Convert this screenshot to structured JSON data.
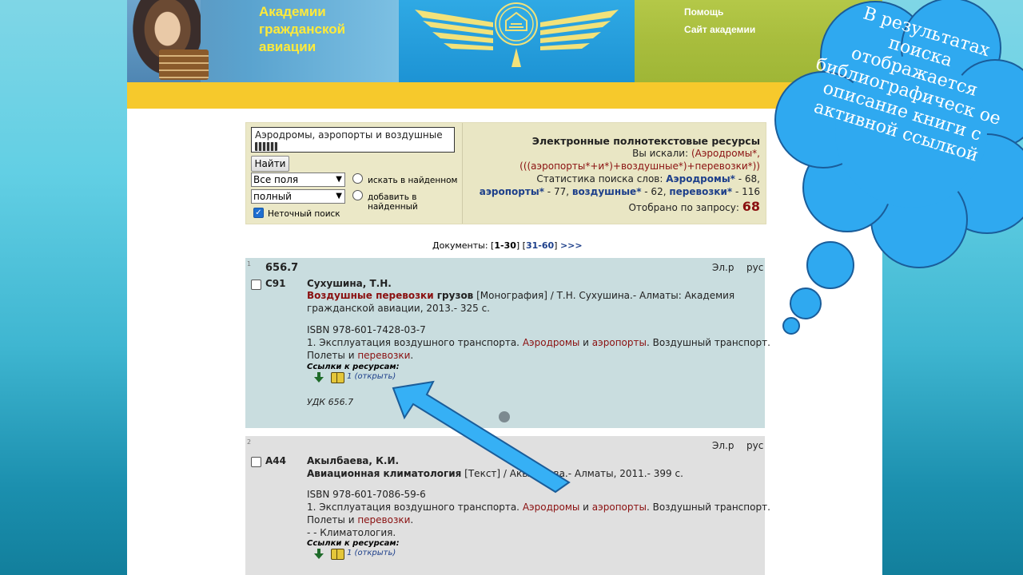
{
  "header": {
    "academy_line1": "Академии",
    "academy_line2": "гражданской",
    "academy_line3": "авиации",
    "help_link": "Помощь",
    "site_link": "Сайт академии"
  },
  "search": {
    "query": "Аэродромы, аэропорты и воздушные",
    "find_button": "Найти",
    "field_select": "Все поля",
    "mode_select": "полный",
    "radio_search_in_found": "искать в найденном",
    "radio_add_to_found": "добавить в найденный",
    "exact_search_label": "Неточный поиск",
    "exact_search_checked": true
  },
  "info": {
    "title": "Электронные полнотекстовые ресурсы",
    "searched_label": "Вы искали:",
    "searched_q1": "(Аэродромы*,",
    "searched_q2": "(((аэропорты*+и*)+воздушные*)+перевозки*))",
    "stats_label": "Статистика поиска слов:",
    "w1": "Аэродромы*",
    "c1": " - 68,",
    "w2": "аэропорты*",
    "c2": " - 77, ",
    "w3": "воздушные*",
    "c3": " - 62, ",
    "w4": "перевозки*",
    "c4": " - 116",
    "selected_label": "Отобрано по запросу:",
    "selected_count": "68"
  },
  "pager": {
    "label": "Документы:",
    "current": "1-30",
    "next_range": "31-60",
    "next_arrows": ">>>"
  },
  "records": [
    {
      "num": "1",
      "class_code": "656.7",
      "el": "Эл.р",
      "lang": "рус",
      "shelf": "С91",
      "author": "Сухушина, Т.Н.",
      "title_hl": "Воздушные перевозки",
      "title_rest": " грузов",
      "desc1": " [Монография] / Т.Н. Сухушина.- Алматы: Академия",
      "desc2": "гражданской авиации, 2013.- 325 с.",
      "isbn": "ISBN 978-601-7428-03-7",
      "subj_a": "1. Эксплуатация воздушного транспорта. ",
      "subj_hl1": "Аэродромы",
      "subj_and1": " и ",
      "subj_hl2": "аэропорты",
      "subj_b": ". Воздушный транспорт.",
      "subj_c": "Полеты и ",
      "subj_hl3": "перевозки",
      "subj_d": ".",
      "links_label": "Ссылки к ресурсам:",
      "open_link": "1 (открыть)",
      "udk": "УДК 656.7"
    },
    {
      "num": "2",
      "el": "Эл.р",
      "lang": "рус",
      "shelf": "А44",
      "author": "Акылбаева, К.И.",
      "title": "Авиационная климатология",
      "desc1": " [Текст] / Акылбаева.- Алматы, 2011.- 399 с.",
      "isbn": "ISBN 978-601-7086-59-6",
      "subj_a": "1. Эксплуатация воздушного транспорта. ",
      "subj_hl1": "Аэродромы",
      "subj_and1": " и ",
      "subj_hl2": "аэропорты",
      "subj_b": ". Воздушный транспорт.",
      "subj_c": "Полеты и ",
      "subj_hl3": "перевозки",
      "subj_d": ".",
      "subj_e": "- - Климатология.",
      "links_label": "Ссылки к ресурсам:",
      "open_link": "1 (открыть)"
    }
  ],
  "callout": {
    "text": "В результатах поиска отображается библиографическ ое описание книги с активной ссылкой",
    "color": "#2fa9f0"
  }
}
